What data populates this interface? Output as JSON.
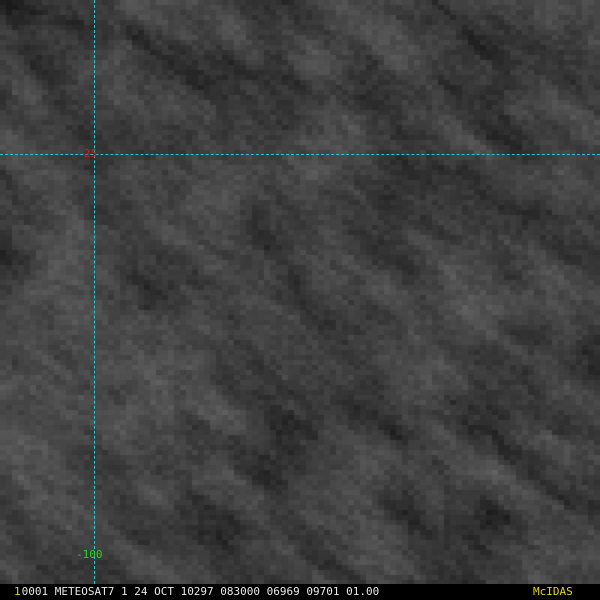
{
  "image": {
    "satellite_view": "infrared-like grayscale satellite imagery",
    "palette": {
      "dark": "#252525",
      "mid": "#454545",
      "light": "#7a7a7a"
    }
  },
  "gridlines": {
    "color": "#22c8cc",
    "latitude": {
      "label": "25",
      "color": "#c81e1e"
    },
    "longitude": {
      "label": "-100",
      "color": "#2bd42b"
    }
  },
  "status_bar": {
    "frame_index": "1",
    "frame_index_color": "#e8d800",
    "info": "0001 METEOSAT7  1 24 OCT 10297 083000 06969 09701 01.00",
    "info_color": "#e8e8e8",
    "brand": "McIDAS",
    "brand_color": "#e8d800"
  }
}
